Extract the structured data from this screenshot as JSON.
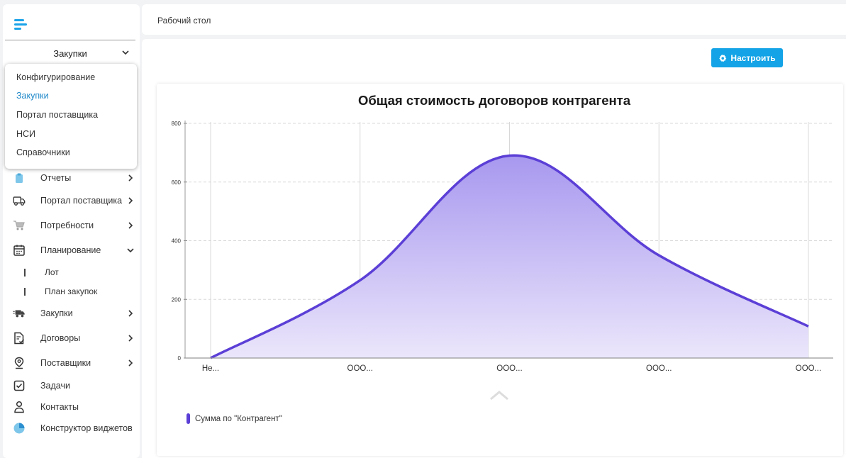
{
  "sidebar": {
    "module_select": "Закупки",
    "dropdown_items": [
      {
        "label": "Конфигурирование",
        "active": false
      },
      {
        "label": "Закупки",
        "active": true
      },
      {
        "label": "Портал поставщика",
        "active": false
      },
      {
        "label": "НСИ",
        "active": false
      },
      {
        "label": "Справочники",
        "active": false
      }
    ],
    "items": [
      {
        "label": "Отчеты",
        "icon": "clipboard-icon",
        "arrow": "chevron-right"
      },
      {
        "label": "Портал поставщика",
        "icon": "truck-icon",
        "arrow": "chevron-right"
      },
      {
        "label": "Потребности",
        "icon": "cart-icon",
        "arrow": "chevron-right"
      },
      {
        "label": "Планирование",
        "icon": "calendar-icon",
        "arrow": "chevron-down"
      },
      {
        "label": "Закупки",
        "icon": "delivery-truck-icon",
        "arrow": "chevron-right"
      },
      {
        "label": "Договоры",
        "icon": "document-check-icon",
        "arrow": "chevron-right"
      },
      {
        "label": "Поставщики",
        "icon": "location-pin-icon",
        "arrow": "chevron-right"
      },
      {
        "label": "Задачи",
        "icon": "checkbox-icon",
        "arrow": ""
      },
      {
        "label": "Контакты",
        "icon": "person-icon",
        "arrow": ""
      },
      {
        "label": "Конструктор виджетов",
        "icon": "pie-chart-icon",
        "arrow": ""
      }
    ],
    "sub_items": [
      {
        "label": "Лот"
      },
      {
        "label": "План закупок"
      }
    ]
  },
  "header": {
    "breadcrumb": "Рабочий стол"
  },
  "toolbar": {
    "configure_label": "Настроить",
    "configure_icon": "gear-icon"
  },
  "colors": {
    "accent": "#13a3e6",
    "series": "#5b3fd6",
    "fill_top": "#a898ef",
    "fill_bottom": "#ebe6fb",
    "active_menu": "#1e88c9"
  },
  "chart_data": {
    "type": "area",
    "title": "Общая стоимость договоров контрагента",
    "categories": [
      "Не...",
      "ООО...",
      "ООО...",
      "ООО...",
      "ООО..."
    ],
    "series": [
      {
        "name": "Сумма по \"Контрагент\"",
        "values": [
          0,
          265,
          690,
          350,
          108
        ]
      }
    ],
    "ylim": [
      0,
      800
    ],
    "yticks": [
      "0",
      "200",
      "400",
      "600",
      "800"
    ],
    "grid": true,
    "smooth": true,
    "legend_position": "bottom-left"
  }
}
